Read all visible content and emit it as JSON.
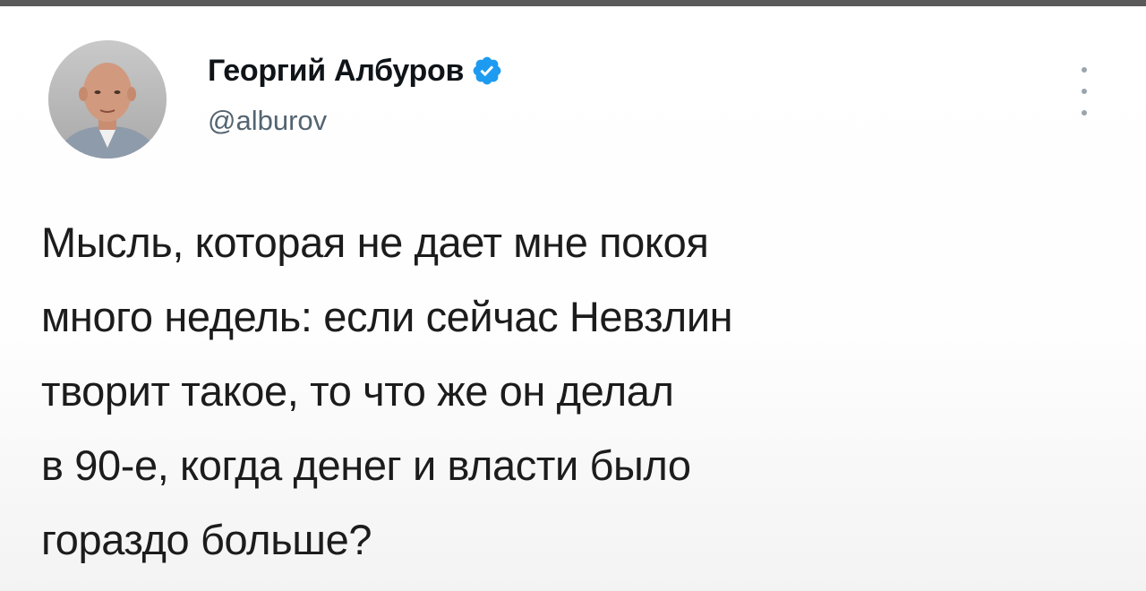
{
  "tweet": {
    "author": {
      "display_name": "Георгий Албуров",
      "handle": "@alburov",
      "verified": true,
      "avatar_icon": "profile-photo",
      "verified_icon": "verified-badge-icon"
    },
    "more_icon": "more-options-icon",
    "text_lines": [
      "Мысль, которая не дает мне покоя",
      "много недель: если сейчас Невзлин",
      "творит такое, то что же он делал",
      "в 90-е, когда денег и власти было",
      "гораздо больше?"
    ]
  },
  "colors": {
    "verified_blue": "#1d9bf0",
    "text": "#1c1c1c",
    "handle": "#536471",
    "top_bar": "#5a5a5a"
  }
}
